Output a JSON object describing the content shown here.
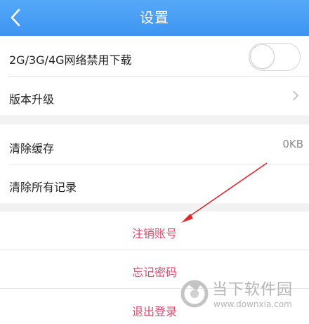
{
  "header": {
    "title": "设置",
    "back_icon": "chevron-left-icon",
    "color": "#4a9ff5"
  },
  "settings": {
    "network_download": {
      "label": "2G/3G/4G网络禁用下载",
      "enabled": false
    },
    "version_upgrade": {
      "label": "版本升级",
      "icon": "chevron-right-icon"
    },
    "clear_cache": {
      "label": "清除缓存",
      "value": "0KB"
    },
    "clear_records": {
      "label": "清除所有记录"
    }
  },
  "actions": {
    "cancel_account": "注销账号",
    "forgot_password": "忘记密码",
    "logout": "退出登录",
    "color": "#e2486b"
  },
  "watermark": {
    "text": "当下软件园",
    "url": "www.downxia.com"
  },
  "annotation": {
    "color": "#e3242b",
    "icon": "red-arrow"
  }
}
